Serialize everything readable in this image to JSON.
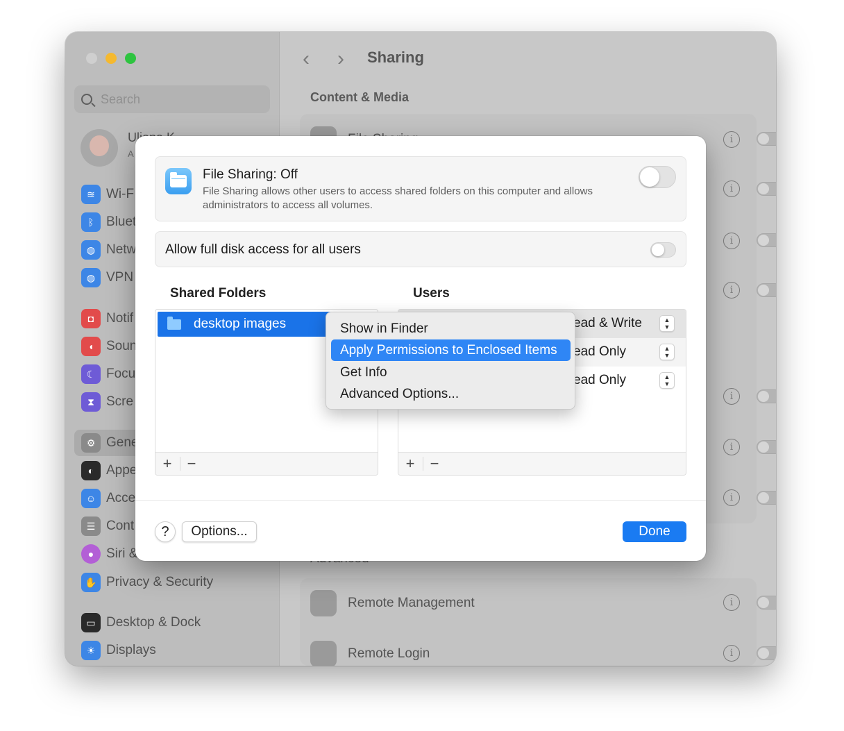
{
  "window": {
    "traffic_colors": [
      "#cfcfcf",
      "#f5b92f",
      "#2ec440"
    ],
    "search_placeholder": "Search",
    "account": {
      "name": "Uliana K",
      "subtitle": "A"
    }
  },
  "sidebar": {
    "items": [
      {
        "label": "Wi-F",
        "icon": "wifi-icon",
        "color": "#3d86e6"
      },
      {
        "label": "Bluet",
        "icon": "bluetooth-icon",
        "color": "#3d86e6"
      },
      {
        "label": "Netw",
        "icon": "globe-icon",
        "color": "#3d86e6"
      },
      {
        "label": "VPN",
        "icon": "vpn-globe-icon",
        "color": "#3d86e6"
      },
      {
        "label": "Notif",
        "icon": "bell-icon",
        "color": "#e24b4b"
      },
      {
        "label": "Soun",
        "icon": "speaker-icon",
        "color": "#e24b4b"
      },
      {
        "label": "Focu",
        "icon": "moon-icon",
        "color": "#6e5bd6"
      },
      {
        "label": "Scre",
        "icon": "hourglass-icon",
        "color": "#6e5bd6"
      },
      {
        "label": "Gene",
        "icon": "gear-icon",
        "color": "#8a8a8a"
      },
      {
        "label": "Appe",
        "icon": "appearance-icon",
        "color": "#2a2a2a"
      },
      {
        "label": "Acce",
        "icon": "accessibility-icon",
        "color": "#3d86e6"
      },
      {
        "label": "Cont",
        "icon": "control-center-icon",
        "color": "#8a8a8a"
      },
      {
        "label": "Siri &",
        "icon": "siri-icon",
        "color": "#b35fd6"
      },
      {
        "label": "Privacy & Security",
        "icon": "hand-icon",
        "color": "#3d86e6"
      },
      {
        "label": "Desktop & Dock",
        "icon": "dock-icon",
        "color": "#2a2a2a"
      },
      {
        "label": "Displays",
        "icon": "sun-icon",
        "color": "#3d86e6"
      }
    ]
  },
  "main": {
    "title": "Sharing",
    "section_content": "Content & Media",
    "section_advanced": "Advanced",
    "row_file_sharing": "File Sharing",
    "remote_management": "Remote Management",
    "remote_login": "Remote Login"
  },
  "dialog": {
    "file_sharing_title": "File Sharing: Off",
    "file_sharing_desc": "File Sharing allows other users to access shared folders on this computer and allows administrators to access all volumes.",
    "full_disk_label": "Allow full disk access for all users",
    "shared_folders_title": "Shared Folders",
    "users_title": "Users",
    "folders": [
      "desktop images"
    ],
    "users": [
      {
        "permission": "ead & Write"
      },
      {
        "permission": "ead Only"
      },
      {
        "permission": "ead Only"
      }
    ],
    "context_menu": [
      "Show in Finder",
      "Apply Permissions to Enclosed Items",
      "Get Info",
      "Advanced Options..."
    ],
    "help_label": "?",
    "options_label": "Options...",
    "done_label": "Done",
    "plus": "+",
    "minus": "−"
  }
}
